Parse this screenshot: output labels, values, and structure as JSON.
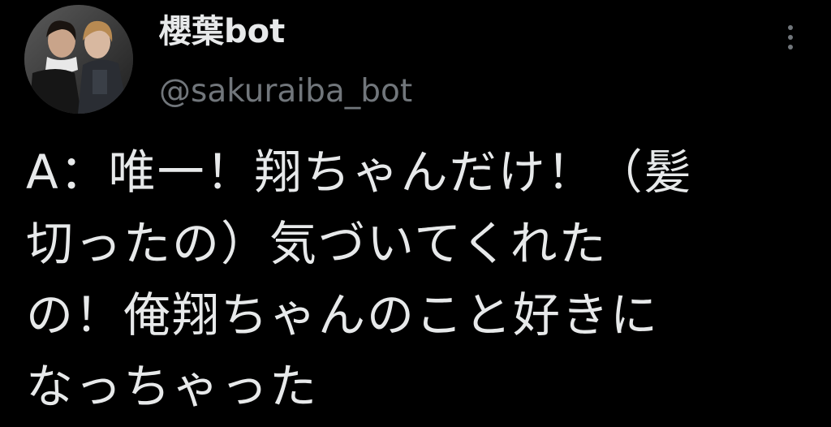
{
  "author": {
    "display_name": "櫻葉bot",
    "handle": "@sakuraiba_bot",
    "avatar_icon": "profile-photo-icon"
  },
  "more_icon": "more-vertical-icon",
  "tweet": {
    "lines": [
      "A：唯一！翔ちゃんだけ！（髪",
      "切ったの）気づいてくれた",
      "の！俺翔ちゃんのこと好きに",
      "なっちゃった"
    ]
  },
  "colors": {
    "background": "#000000",
    "primary_text": "#e7e9ea",
    "secondary_text": "#71767b"
  }
}
